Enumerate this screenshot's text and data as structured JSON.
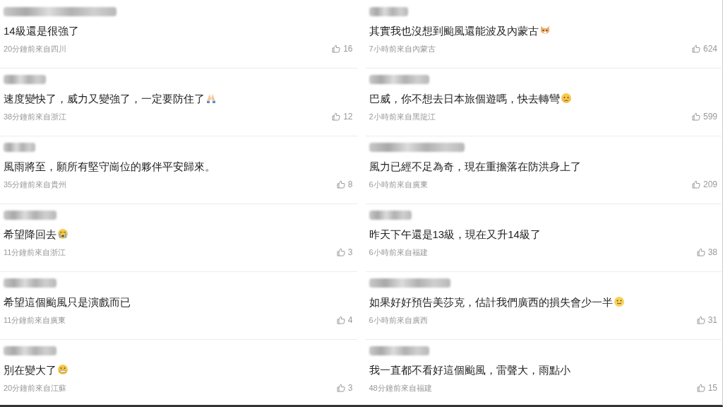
{
  "columns": [
    {
      "comments": [
        {
          "text": "14級還是很強了",
          "meta": "20分鐘前來自四川",
          "likes": "16"
        },
        {
          "text": "速度變快了，威力又變強了，一定要防住了",
          "emoji": {
            "kind": "pray"
          },
          "meta": "38分鐘前來自浙江",
          "likes": "12"
        },
        {
          "text": "風雨將至，願所有堅守崗位的夥伴平安歸來。",
          "meta": "35分鐘前來自貴州",
          "likes": "8"
        },
        {
          "text": "希望降回去",
          "emoji": {
            "kind": "cry"
          },
          "meta": "11分鐘前來自浙江",
          "likes": "3"
        },
        {
          "text": "希望這個颱風只是演戲而已",
          "meta": "11分鐘前來自廣東",
          "likes": "4"
        },
        {
          "text": "別在變大了",
          "emoji": {
            "kind": "grimace"
          },
          "meta": "20分鐘前來自江蘇",
          "likes": "3"
        }
      ]
    },
    {
      "comments": [
        {
          "text": "其實我也沒想到颱風還能波及內蒙古",
          "emoji": {
            "kind": "cat"
          },
          "meta": "7小時前來自內蒙古",
          "likes": "624"
        },
        {
          "text": "巴威，你不想去日本旅個遊嗎，快去轉彎",
          "emoji": {
            "kind": "sad"
          },
          "meta": "2小時前來自黑龍江",
          "likes": "599"
        },
        {
          "text": "風力已經不足為奇，現在重擔落在防洪身上了",
          "meta": "6小時前來自廣東",
          "likes": "209"
        },
        {
          "text": "昨天下午還是13級，現在又升14級了",
          "meta": "6小時前來自福建",
          "likes": "38"
        },
        {
          "text": "如果好好預告美莎克，估計我們廣西的損失會少一半",
          "emoji": {
            "kind": "smile"
          },
          "meta": "6小時前來自廣西",
          "likes": "31"
        },
        {
          "text": "我一直都不看好這個颱風，雷聲大，雨點小",
          "meta": "48分鐘前來自福建",
          "likes": "15"
        }
      ]
    }
  ]
}
